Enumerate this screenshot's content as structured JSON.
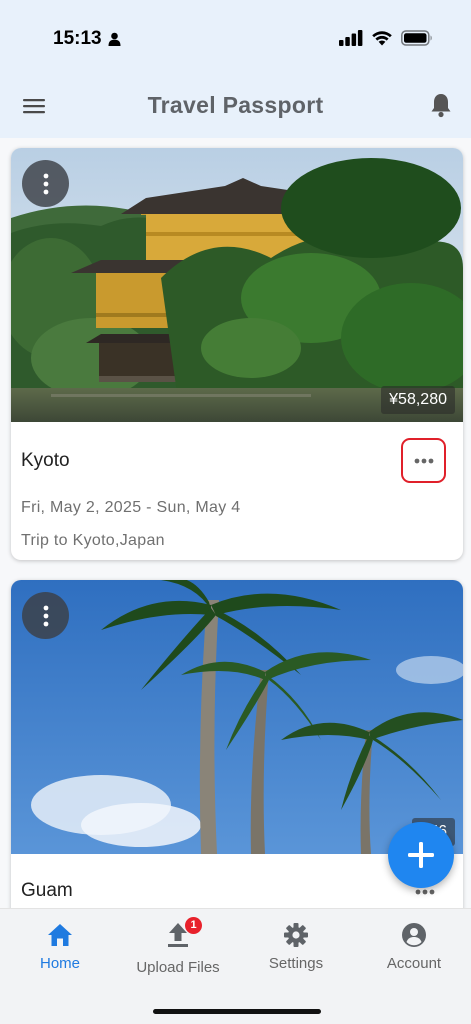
{
  "status_bar": {
    "time": "15:13"
  },
  "app_bar": {
    "title": "Travel Passport"
  },
  "trips": [
    {
      "title": "Kyoto",
      "price": "¥58,280",
      "dates": "Fri, May 2, 2025 - Sun, May 4",
      "description": "Trip to Kyoto,Japan"
    },
    {
      "title": "Guam",
      "price": "¥56"
    }
  ],
  "bottom_nav": {
    "items": [
      {
        "label": "Home",
        "icon": "home-icon"
      },
      {
        "label": "Upload Files",
        "icon": "upload-icon",
        "badge": "1"
      },
      {
        "label": "Settings",
        "icon": "gear-icon"
      },
      {
        "label": "Account",
        "icon": "account-circle-icon"
      }
    ]
  },
  "colors": {
    "accent": "#1f86f0",
    "active_nav": "#1f7ae0",
    "header_bg": "#e8f1fb",
    "highlight_border": "#e0202a",
    "badge": "#e8212b"
  }
}
